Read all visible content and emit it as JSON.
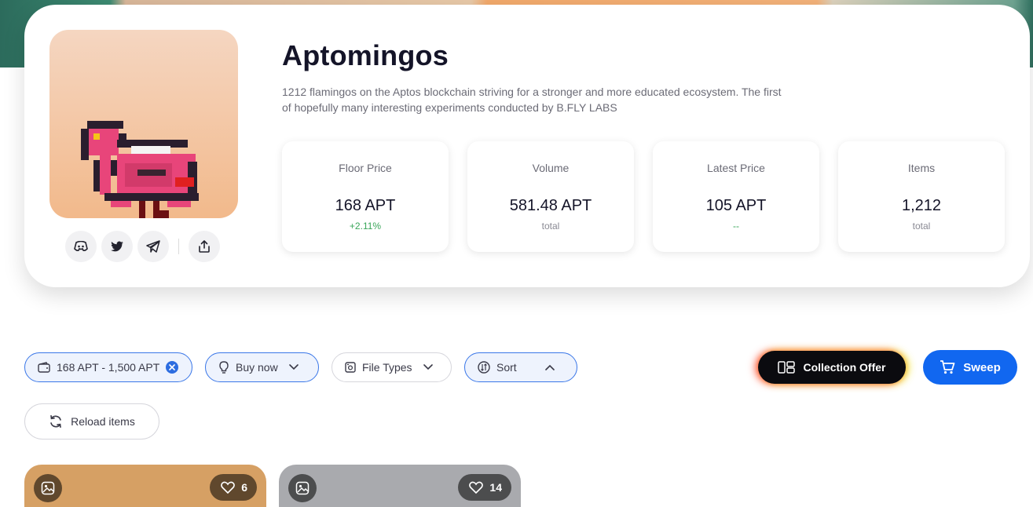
{
  "collection": {
    "name": "Aptomingos",
    "description": "1212 flamingos on the Aptos blockchain striving for a stronger and more educated ecosystem. The first of hopefully many interesting experiments conducted by B.FLY LABS",
    "avatar_icon": "flamingo-pixel-art"
  },
  "socials": [
    "discord-icon",
    "twitter-icon",
    "telegram-icon",
    "share-icon"
  ],
  "stats": [
    {
      "label": "Floor Price",
      "value": "168 APT",
      "sub": "+2.11%"
    },
    {
      "label": "Volume",
      "value": "581.48 APT",
      "sub": "total"
    },
    {
      "label": "Latest Price",
      "value": "105 APT",
      "sub": "--"
    },
    {
      "label": "Items",
      "value": "1,212",
      "sub": "total"
    }
  ],
  "filters": {
    "price_range": "168 APT - 1,500 APT",
    "buy_now": "Buy now",
    "file_types": "File Types",
    "sort": "Sort"
  },
  "actions": {
    "collection_offer": "Collection Offer",
    "sweep": "Sweep",
    "reload": "Reload items"
  },
  "items": [
    {
      "likes": "6",
      "bg": "#d6a064"
    },
    {
      "likes": "14",
      "bg": "#a9aaae"
    }
  ],
  "colors": {
    "accent": "#1167f0",
    "positive": "#3aa65a"
  }
}
